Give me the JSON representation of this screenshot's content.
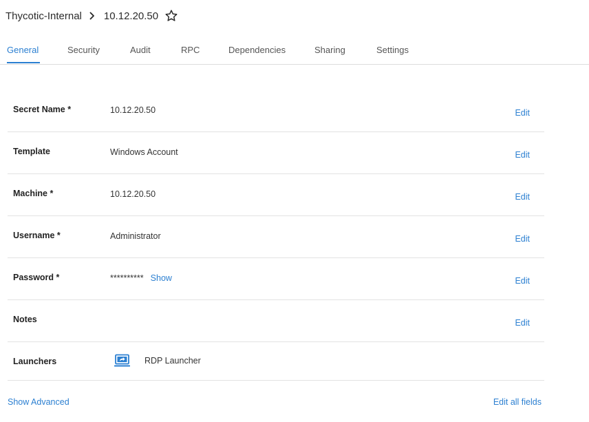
{
  "header": {
    "folder": "Thycotic-Internal",
    "secret_title": "10.12.20.50"
  },
  "tabs": [
    {
      "label": "General",
      "active": true
    },
    {
      "label": "Security",
      "active": false
    },
    {
      "label": "Audit",
      "active": false
    },
    {
      "label": "RPC",
      "active": false
    },
    {
      "label": "Dependencies",
      "active": false
    },
    {
      "label": "Sharing",
      "active": false
    },
    {
      "label": "Settings",
      "active": false
    }
  ],
  "fields": {
    "secret_name": {
      "label": "Secret Name *",
      "value": "10.12.20.50",
      "edit": "Edit"
    },
    "template": {
      "label": "Template",
      "value": "Windows Account",
      "edit": "Edit"
    },
    "machine": {
      "label": "Machine *",
      "value": "10.12.20.50",
      "edit": "Edit"
    },
    "username": {
      "label": "Username *",
      "value": "Administrator",
      "edit": "Edit"
    },
    "password": {
      "label": "Password *",
      "value": "**********",
      "show": "Show",
      "edit": "Edit"
    },
    "notes": {
      "label": "Notes",
      "value": "",
      "edit": "Edit"
    },
    "launchers": {
      "label": "Launchers",
      "items": [
        {
          "label": "RDP Launcher",
          "icon": "rdp-launcher-icon"
        }
      ]
    }
  },
  "footer": {
    "show_advanced": "Show Advanced",
    "edit_all_fields": "Edit all fields"
  },
  "colors": {
    "accent": "#2b7fd1",
    "text": "#222222",
    "divider": "#e2e2e2"
  },
  "icons": {
    "breadcrumb_separator": "chevron-right-icon",
    "favorite": "star-outline-icon",
    "launcher": "rdp-launcher-icon"
  }
}
